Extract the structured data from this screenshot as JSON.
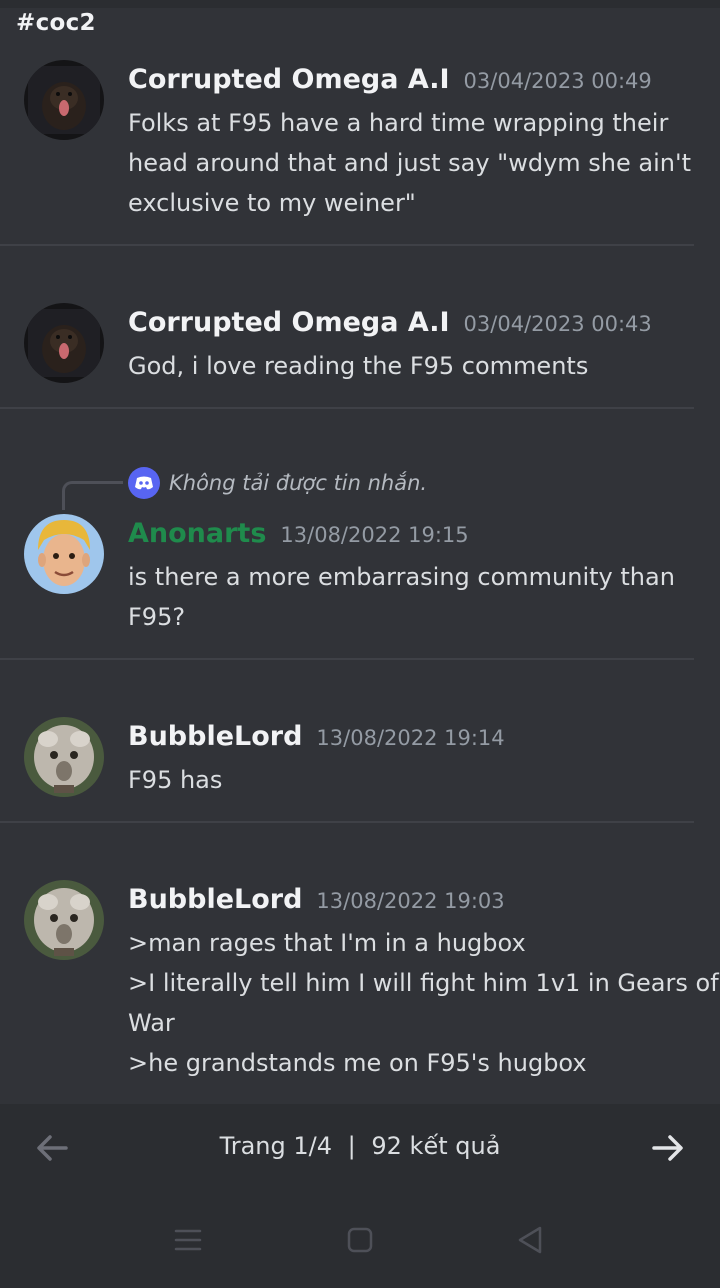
{
  "channel": {
    "name": "#coc2"
  },
  "messages": [
    {
      "author": "Corrupted Omega A.I",
      "timestamp": "03/04/2023 00:49",
      "lines": [
        "Folks at F95 have a hard time wrapping their",
        "head around that and just say \"wdym she ain't",
        "exclusive to my weiner\""
      ],
      "avatar": "dog-avatar"
    },
    {
      "author": "Corrupted Omega A.I",
      "timestamp": "03/04/2023 00:43",
      "lines": [
        "God, i love reading the F95 comments"
      ],
      "avatar": "dog-avatar"
    },
    {
      "reply_note": "Không tải được tin nhắn.",
      "author": "Anonarts",
      "author_color": "#1f8b4c",
      "timestamp": "13/08/2022 19:15",
      "lines": [
        "is there a more embarrasing community than",
        "F95?"
      ],
      "avatar": "cartoon-face-avatar"
    },
    {
      "author": "BubbleLord",
      "timestamp": "13/08/2022 19:14",
      "lines": [
        "F95 has"
      ],
      "avatar": "creature-avatar"
    },
    {
      "author": "BubbleLord",
      "timestamp": "13/08/2022 19:03",
      "lines": [
        ">man rages that I'm in a hugbox",
        ">I literally tell him I will fight him 1v1 in Gears of",
        "War",
        ">he grandstands me on F95's hugbox"
      ],
      "avatar": "creature-avatar"
    }
  ],
  "pagination": {
    "page_label": "Trang 1/4",
    "divider": "|",
    "results_label": "92 kết quả"
  },
  "icons": {
    "prev": "arrow-left-icon",
    "next": "arrow-right-icon",
    "recents": "menu-lines-icon",
    "home": "square-icon",
    "back": "triangle-back-icon",
    "reply_app": "discord-icon"
  },
  "colors": {
    "background": "#313338",
    "footer": "#2b2d31",
    "accent": "#5865f2",
    "green_author": "#1f8b4c"
  }
}
